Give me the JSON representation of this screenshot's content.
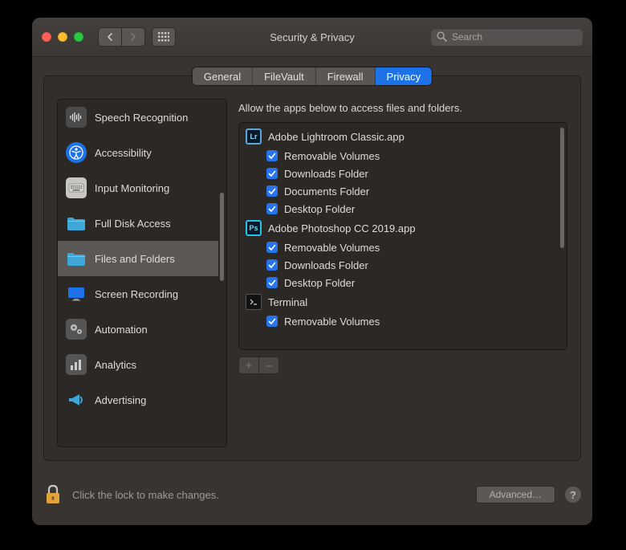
{
  "window": {
    "title": "Security & Privacy",
    "search_placeholder": "Search"
  },
  "tabs": [
    {
      "label": "General",
      "active": false
    },
    {
      "label": "FileVault",
      "active": false
    },
    {
      "label": "Firewall",
      "active": false
    },
    {
      "label": "Privacy",
      "active": true
    }
  ],
  "sidebar": {
    "items": [
      {
        "label": "Speech Recognition",
        "icon": "waveform"
      },
      {
        "label": "Accessibility",
        "icon": "accessibility"
      },
      {
        "label": "Input Monitoring",
        "icon": "keyboard"
      },
      {
        "label": "Full Disk Access",
        "icon": "folder"
      },
      {
        "label": "Files and Folders",
        "icon": "folder",
        "selected": true
      },
      {
        "label": "Screen Recording",
        "icon": "screen"
      },
      {
        "label": "Automation",
        "icon": "gears"
      },
      {
        "label": "Analytics",
        "icon": "chart"
      },
      {
        "label": "Advertising",
        "icon": "megaphone"
      }
    ]
  },
  "main": {
    "hint": "Allow the apps below to access files and folders.",
    "apps": [
      {
        "name": "Adobe Lightroom Classic.app",
        "icon": "lightroom",
        "permissions": [
          {
            "label": "Removable Volumes",
            "checked": true
          },
          {
            "label": "Downloads Folder",
            "checked": true
          },
          {
            "label": "Documents Folder",
            "checked": true
          },
          {
            "label": "Desktop Folder",
            "checked": true
          }
        ]
      },
      {
        "name": "Adobe Photoshop CC 2019.app",
        "icon": "photoshop",
        "permissions": [
          {
            "label": "Removable Volumes",
            "checked": true
          },
          {
            "label": "Downloads Folder",
            "checked": true
          },
          {
            "label": "Desktop Folder",
            "checked": true
          }
        ]
      },
      {
        "name": "Terminal",
        "icon": "terminal",
        "permissions": [
          {
            "label": "Removable Volumes",
            "checked": true
          }
        ]
      }
    ],
    "add_label": "+",
    "remove_label": "–"
  },
  "footer": {
    "lock_text": "Click the lock to make changes.",
    "advanced_label": "Advanced…",
    "help_label": "?"
  },
  "icons": {
    "lightroom_text": "Lr",
    "photoshop_text": "Ps"
  }
}
